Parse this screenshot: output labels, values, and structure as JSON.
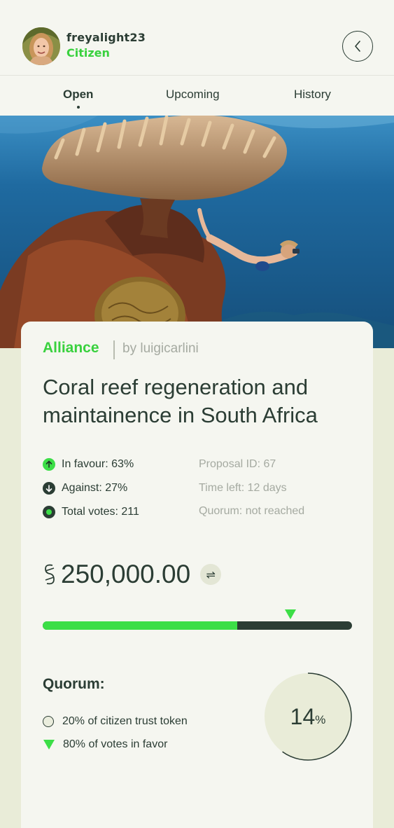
{
  "header": {
    "username": "freyalight23",
    "role": "Citizen",
    "back_icon": "chevron-left-icon"
  },
  "tabs": [
    {
      "label": "Open",
      "active": true
    },
    {
      "label": "Upcoming",
      "active": false
    },
    {
      "label": "History",
      "active": false
    }
  ],
  "proposal": {
    "category": "Alliance",
    "author": "by luigicarlini",
    "title": "Coral reef regeneration and maintainence in South Africa",
    "stats": {
      "in_favour": "In favour: 63%",
      "against": "Against: 27%",
      "total_votes": "Total votes: 211"
    },
    "meta": {
      "proposal_id": "Proposal ID: 67",
      "time_left": "Time left: 12 days",
      "quorum_status": "Quorum: not reached"
    },
    "amount": "250,000.00",
    "currency_icon": "currency-symbol-icon",
    "swap_icon": "swap-arrows-icon",
    "favour_fraction": 0.63,
    "target_fraction": 0.8
  },
  "quorum": {
    "title": "Quorum:",
    "items": [
      {
        "label": "20% of citizen trust token",
        "icon": "circle-icon"
      },
      {
        "label": "80% of votes in favor",
        "icon": "triangle-down-icon"
      }
    ],
    "progress_value": "14",
    "progress_unit": "%",
    "progress_fraction": 0.14
  },
  "colors": {
    "accent_green": "#39d13e",
    "dark": "#2b3d34",
    "muted": "#a5aaa1",
    "card": "#f5f6f0",
    "page": "#e9ecd8"
  }
}
